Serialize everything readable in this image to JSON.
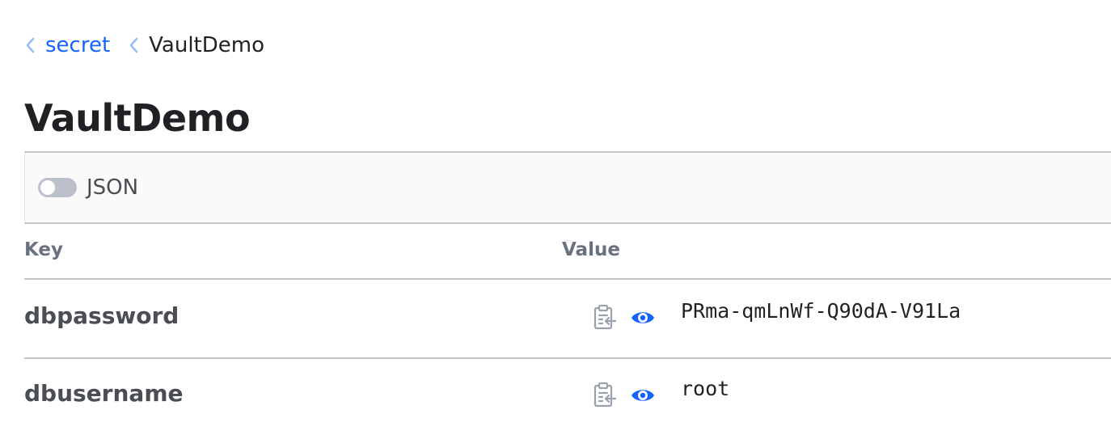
{
  "breadcrumb": {
    "items": [
      {
        "label": "secret"
      },
      {
        "label": "VaultDemo"
      }
    ]
  },
  "page": {
    "title": "VaultDemo"
  },
  "toolbar": {
    "json_toggle_label": "JSON",
    "json_toggle_on": false
  },
  "table": {
    "headers": {
      "key": "Key",
      "value": "Value"
    },
    "rows": [
      {
        "key": "dbpassword",
        "value": "PRma-qmLnWf-Q90dA-V91La"
      },
      {
        "key": "dbusername",
        "value": "root"
      }
    ]
  },
  "colors": {
    "link": "#1563ff",
    "eye_icon": "#1563ff",
    "copy_icon": "#9aa1ad",
    "toggle_off": "#bac1cc"
  },
  "icons": {
    "breadcrumb_separator": "chevron-left-icon",
    "copy": "clipboard-copy-icon",
    "reveal": "eye-icon"
  }
}
